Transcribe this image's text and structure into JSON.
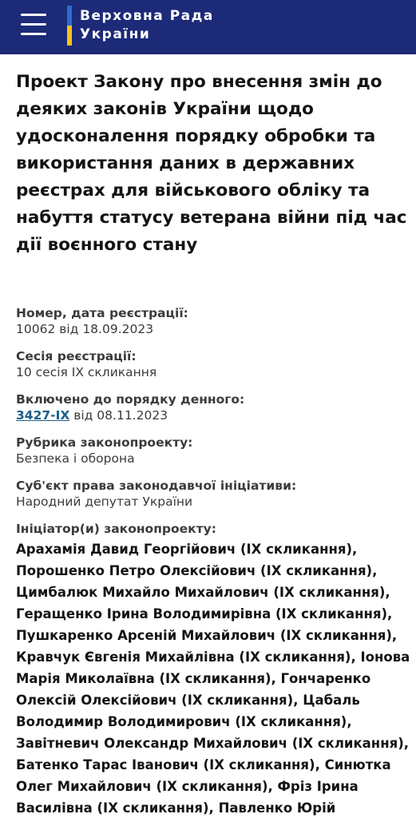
{
  "header": {
    "logo_line1": "Верховна Рада",
    "logo_line2": "України",
    "menu_icon": "hamburger-menu-icon",
    "colors": {
      "background": "#1c2a78",
      "flag_blue": "#2c6ad4",
      "flag_yellow": "#f7c21b"
    }
  },
  "bill": {
    "title": "Проект Закону про внесення змін до деяких законів України щодо удосконалення порядку обробки та використання даних в державних реєстрах для військового обліку та набуття статусу ветерана війни під час дії воєнного стану",
    "registration_label": "Номер, дата реєстрації:",
    "registration_value": "10062 від 18.09.2023",
    "session_label": "Сесія реєстрації:",
    "session_value": "10 сесія IX скликання",
    "agenda_label": "Включено до порядку денного:",
    "agenda_link": "3427-IX",
    "agenda_date": " від 08.11.2023",
    "rubric_label": "Рубрика законопроекту:",
    "rubric_value": "Безпека і оборона",
    "subject_label": "Суб'єкт права законодавчої ініціативи:",
    "subject_value": "Народний депутат України",
    "initiators_label": "Ініціатор(и) законопроекту:",
    "initiators_text": "Арахамія Давид Георгійович (IX скликання), Порошенко Петро Олексійович (IX скликання), Цимбалюк Михайло Михайлович (IX скликання), Геращенко Ірина Володимирівна (IX скликання), Пушкаренко Арсеній Михайлович (IX скликання), Кравчук Євгенія Михайлівна (IX скликання), Іонова Марія Миколаївна (IX скликання), Гончаренко Олексій Олексійович (IX скликання), Цабаль Володимир Володимирович (IX скликання), Завітневич Олександр Михайлович (IX скликання), Батенко Тарас Іванович (IX скликання), Синютка Олег Михайлович (IX скликання), Фріз Ірина Василівна (IX скликання), Павленко Юрій"
  }
}
